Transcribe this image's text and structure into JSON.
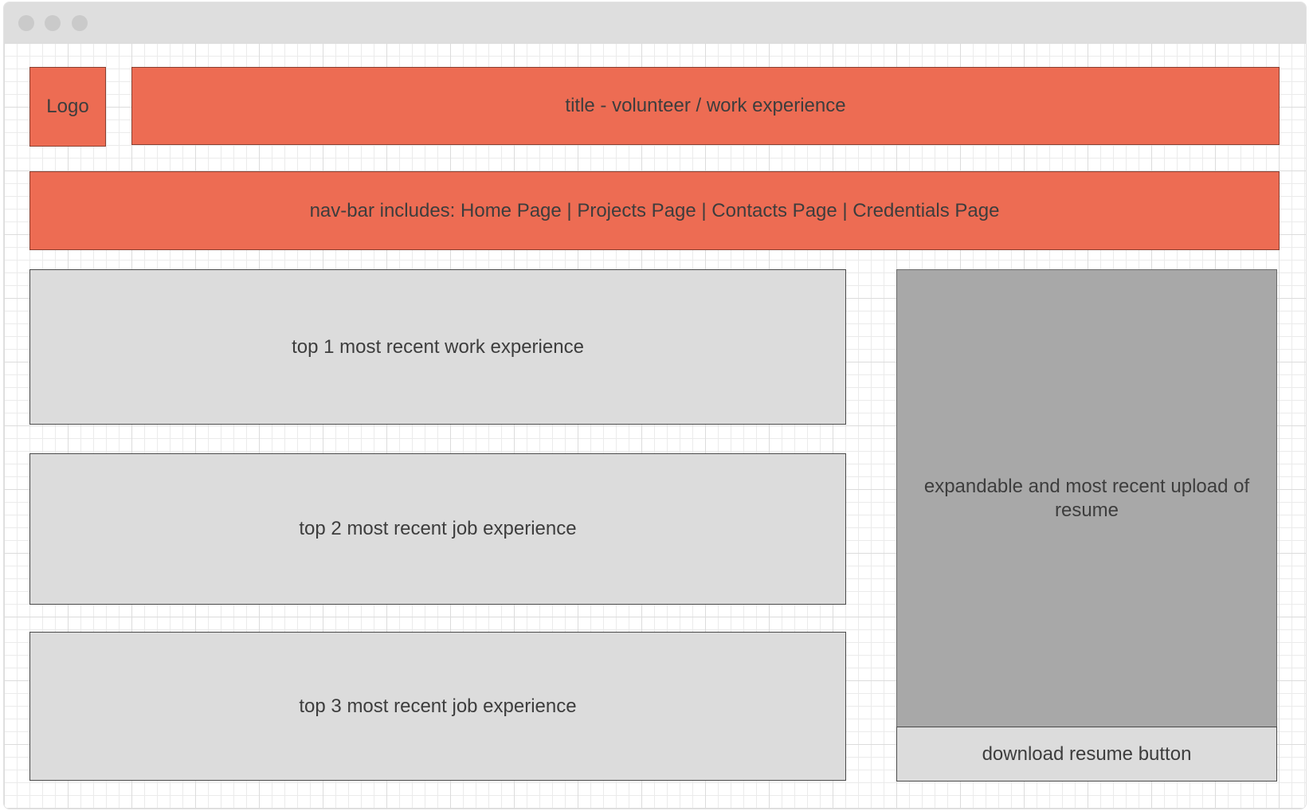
{
  "header": {
    "logo_label": "Logo",
    "title": "title - volunteer / work experience"
  },
  "nav": {
    "text": "nav-bar includes: Home Page | Projects Page | Contacts Page | Credentials Page"
  },
  "experience": {
    "items": [
      "top 1 most recent work experience",
      "top 2 most recent job experience",
      "top 3 most recent job experience"
    ]
  },
  "resume": {
    "preview_text": "expandable and most recent upload of resume",
    "download_label": "download resume button"
  },
  "colors": {
    "accent": "#ed6c53",
    "panel_light": "#dcdcdc",
    "panel_dark": "#a8a8a8",
    "titlebar": "#dedede"
  }
}
